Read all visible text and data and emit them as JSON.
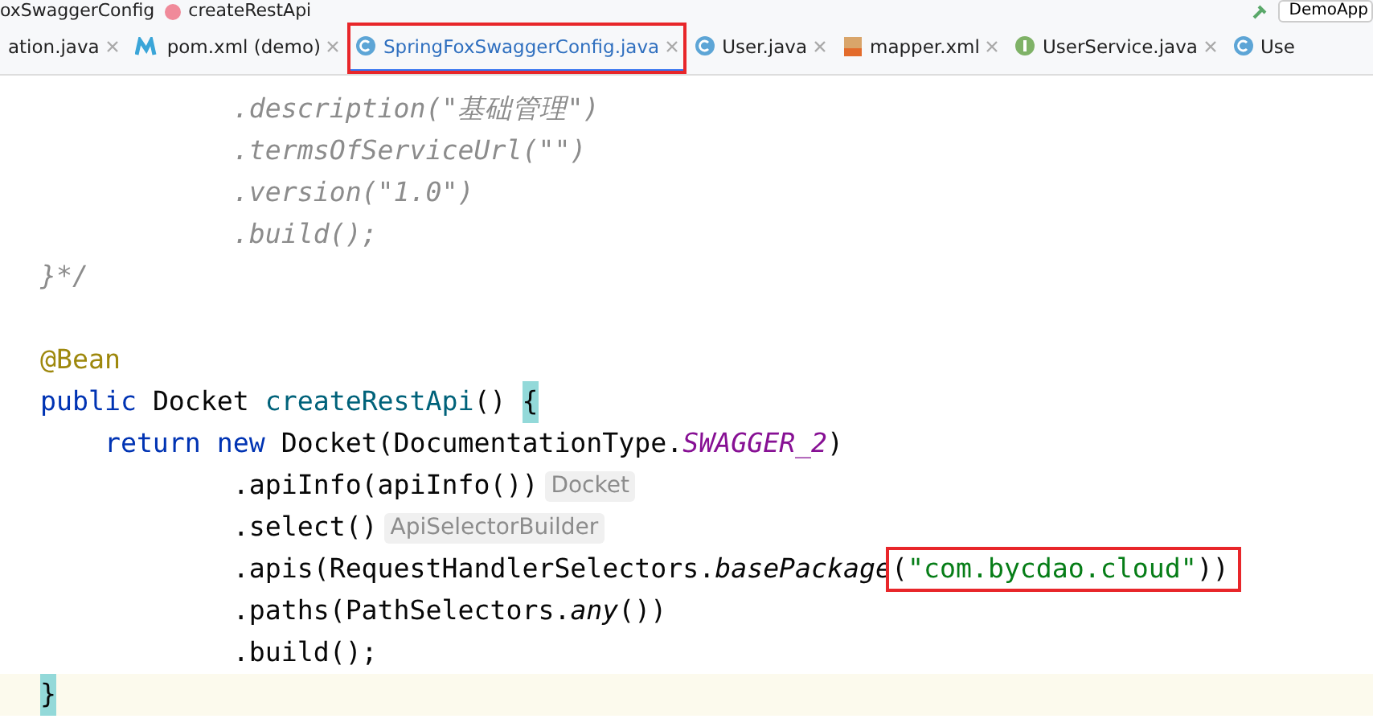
{
  "breadcrumb": [
    {
      "label": "oxSwaggerConfig"
    },
    {
      "label": "createRestApi",
      "kind": "method"
    }
  ],
  "run_config": {
    "label": "DemoApp"
  },
  "tabs": [
    {
      "label": "ation.java",
      "kind": "cut",
      "selected": false,
      "highlighted": false
    },
    {
      "label": "pom.xml (demo)",
      "kind": "maven",
      "selected": false,
      "highlighted": false
    },
    {
      "label": "SpringFoxSwaggerConfig.java",
      "kind": "class",
      "selected": true,
      "highlighted": true
    },
    {
      "label": "User.java",
      "kind": "class",
      "selected": false,
      "highlighted": false
    },
    {
      "label": "mapper.xml",
      "kind": "xml",
      "selected": false,
      "highlighted": false
    },
    {
      "label": "UserService.java",
      "kind": "interface",
      "selected": false,
      "highlighted": false
    },
    {
      "label": "Use",
      "kind": "class",
      "selected": false,
      "highlighted": false
    }
  ],
  "code_lines": [
    {
      "current": false,
      "tokens": [
        {
          "kind": "comment",
          "text": "            .description(\"基础管理\")"
        }
      ]
    },
    {
      "current": false,
      "tokens": [
        {
          "kind": "comment",
          "text": "            .termsOfServiceUrl(\"\")"
        }
      ]
    },
    {
      "current": false,
      "tokens": [
        {
          "kind": "comment",
          "text": "            .version(\"1.0\")"
        }
      ]
    },
    {
      "current": false,
      "tokens": [
        {
          "kind": "comment",
          "text": "            .build();"
        }
      ]
    },
    {
      "current": false,
      "tokens": [
        {
          "kind": "comment",
          "text": "}*/"
        }
      ]
    },
    {
      "current": false
    },
    {
      "current": false,
      "tokens": [
        {
          "kind": "annotation",
          "text": "@Bean"
        }
      ]
    },
    {
      "current": false,
      "tokens": [
        {
          "kind": "keyword",
          "text": "public "
        },
        {
          "kind": "plain",
          "text": "Docket "
        },
        {
          "kind": "method",
          "text": "createRestApi"
        },
        {
          "kind": "plain",
          "text": "() "
        },
        {
          "kind": "brace",
          "text": "{"
        }
      ]
    },
    {
      "current": false,
      "tokens": [
        {
          "kind": "keyword",
          "text": "    return new "
        },
        {
          "kind": "plain",
          "text": "Docket(DocumentationType."
        },
        {
          "kind": "constant",
          "text": "SWAGGER_2"
        },
        {
          "kind": "plain",
          "text": ")"
        }
      ]
    },
    {
      "current": false,
      "tokens": [
        {
          "kind": "plain",
          "text": "            .apiInfo(apiInfo())"
        },
        {
          "kind": "hint",
          "text": "Docket"
        }
      ]
    },
    {
      "current": false,
      "tokens": [
        {
          "kind": "plain",
          "text": "            .select()"
        },
        {
          "kind": "hint",
          "text": "ApiSelectorBuilder"
        }
      ]
    },
    {
      "current": false,
      "tokens": [
        {
          "kind": "plain",
          "text": "            .apis(RequestHandlerSelectors."
        },
        {
          "kind": "italic",
          "text": "basePackage"
        },
        {
          "kind": "boxed",
          "text": "(\"com.bycdao.cloud\"))"
        }
      ]
    },
    {
      "current": false,
      "tokens": [
        {
          "kind": "plain",
          "text": "            .paths(PathSelectors."
        },
        {
          "kind": "italic",
          "text": "any"
        },
        {
          "kind": "plain",
          "text": "())"
        }
      ]
    },
    {
      "current": false,
      "tokens": [
        {
          "kind": "plain",
          "text": "            .build();"
        }
      ]
    },
    {
      "current": true,
      "tokens": [
        {
          "kind": "brace",
          "text": "}"
        }
      ]
    }
  ]
}
